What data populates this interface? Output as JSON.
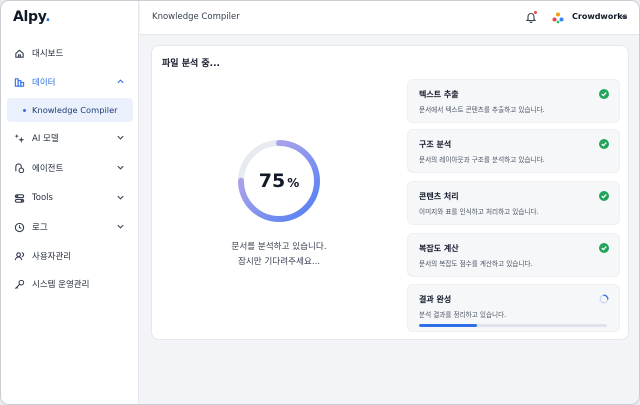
{
  "app": {
    "logo": "Alpy",
    "logo_dot": "."
  },
  "sidebar": {
    "items": [
      {
        "label": "대시보드",
        "icon": "home-icon"
      },
      {
        "label": "데이터",
        "icon": "data-icon",
        "expanded": true
      },
      {
        "label": "AI 모델",
        "icon": "ai-model-icon"
      },
      {
        "label": "에이전트",
        "icon": "agent-icon"
      },
      {
        "label": "Tools",
        "icon": "tools-icon"
      },
      {
        "label": "로그",
        "icon": "log-icon"
      },
      {
        "label": "사용자관리",
        "icon": "user-manage-icon"
      },
      {
        "label": "시스템 운영관리",
        "icon": "key-icon"
      }
    ],
    "sub_item": {
      "label": "Knowledge Compiler",
      "active": true
    }
  },
  "topbar": {
    "title": "Knowledge Compiler",
    "org_name": "Crowdworks"
  },
  "main": {
    "title": "파일 분석 중...",
    "progress": {
      "value": 75,
      "unit": "%"
    },
    "status_line1": "문서를 분석하고 있습니다.",
    "status_line2": "잠시만 기다려주세요...",
    "steps": [
      {
        "title": "텍스트 추출",
        "desc": "문서에서 텍스트 콘텐츠를 추출하고 있습니다.",
        "status": "done"
      },
      {
        "title": "구조 분석",
        "desc": "문서의 레이아웃과 구조를 분석하고 있습니다.",
        "status": "done"
      },
      {
        "title": "콘텐츠 처리",
        "desc": "이미지와 표를 인식하고 처리하고 있습니다.",
        "status": "done"
      },
      {
        "title": "복잡도 계산",
        "desc": "문서의 복잡도 점수를 계산하고 있습니다.",
        "status": "done"
      },
      {
        "title": "결과 완성",
        "desc": "분석 결과를 정리하고 있습니다.",
        "status": "in-progress",
        "progress": 0.31
      }
    ]
  },
  "colors": {
    "accent": "#2f6fe6",
    "success": "#22a55b",
    "ring_start": "#5b7ff0",
    "ring_end": "#b89ee8"
  }
}
